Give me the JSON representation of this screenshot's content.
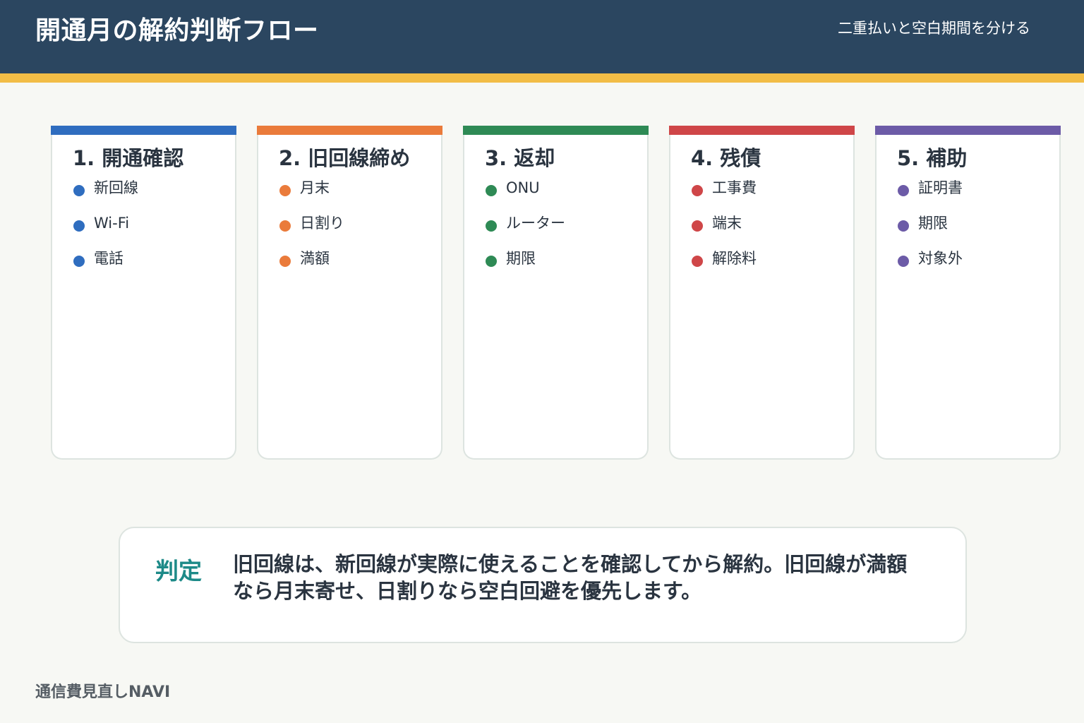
{
  "header": {
    "title": "開通月の解約判断フロー",
    "subtitle": "二重払いと空白期間を分ける"
  },
  "colors": {
    "header_bg": "#2b4660",
    "accent_stripe": "#f2bd46",
    "verdict_label": "#1d8a88"
  },
  "steps": [
    {
      "title": "1. 開通確認",
      "color": "#2f6dbf",
      "items": [
        "新回線",
        "Wi-Fi",
        "電話"
      ]
    },
    {
      "title": "2. 旧回線締め",
      "color": "#ea7b3b",
      "items": [
        "月末",
        "日割り",
        "満額"
      ]
    },
    {
      "title": "3. 返却",
      "color": "#2e8a55",
      "items": [
        "ONU",
        "ルーター",
        "期限"
      ]
    },
    {
      "title": "4. 残債",
      "color": "#cf4648",
      "items": [
        "工事費",
        "端末",
        "解除料"
      ]
    },
    {
      "title": "5. 補助",
      "color": "#6c5ba7",
      "items": [
        "証明書",
        "期限",
        "対象外"
      ]
    }
  ],
  "verdict": {
    "label": "判定",
    "text": "旧回線は、新回線が実際に使えることを確認してから解約。旧回線が満額なら月末寄せ、日割りなら空白回避を優先します。"
  },
  "footer": {
    "brand": "通信費見直しNAVI"
  }
}
